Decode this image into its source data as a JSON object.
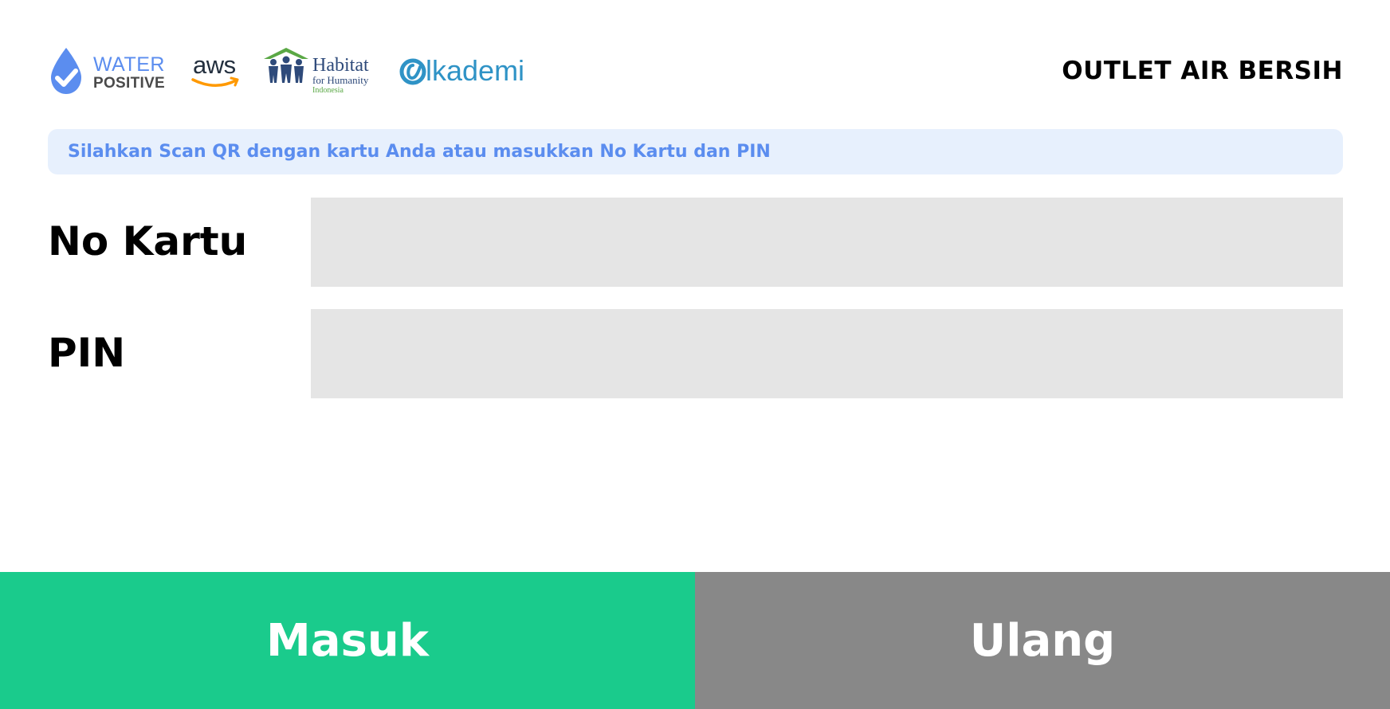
{
  "header": {
    "logos": {
      "water_positive": {
        "line1": "WATER",
        "line2": "POSITIVE",
        "icon": "water-drop-check-icon"
      },
      "aws": {
        "text": "aws",
        "icon": "amazon-smile-icon"
      },
      "habitat": {
        "line1": "Habitat",
        "line2": "for Humanity",
        "line3": "Indonesia",
        "icon": "habitat-house-people-icon"
      },
      "alkademi": {
        "text": "lkademi",
        "icon": "alkademi-a-icon"
      }
    },
    "title": "OUTLET AIR BERSIH"
  },
  "banner": {
    "text": "Silahkan Scan QR dengan kartu Anda atau masukkan No Kartu dan PIN"
  },
  "form": {
    "card": {
      "label": "No Kartu",
      "value": "",
      "placeholder": ""
    },
    "pin": {
      "label": "PIN",
      "value": "",
      "placeholder": ""
    }
  },
  "buttons": {
    "submit": "Masuk",
    "reset": "Ulang"
  },
  "colors": {
    "brand_blue": "#5b8def",
    "banner_bg": "#e7f0fd",
    "input_bg": "#e5e5e5",
    "submit_bg": "#1acb8c",
    "reset_bg": "#888888"
  }
}
